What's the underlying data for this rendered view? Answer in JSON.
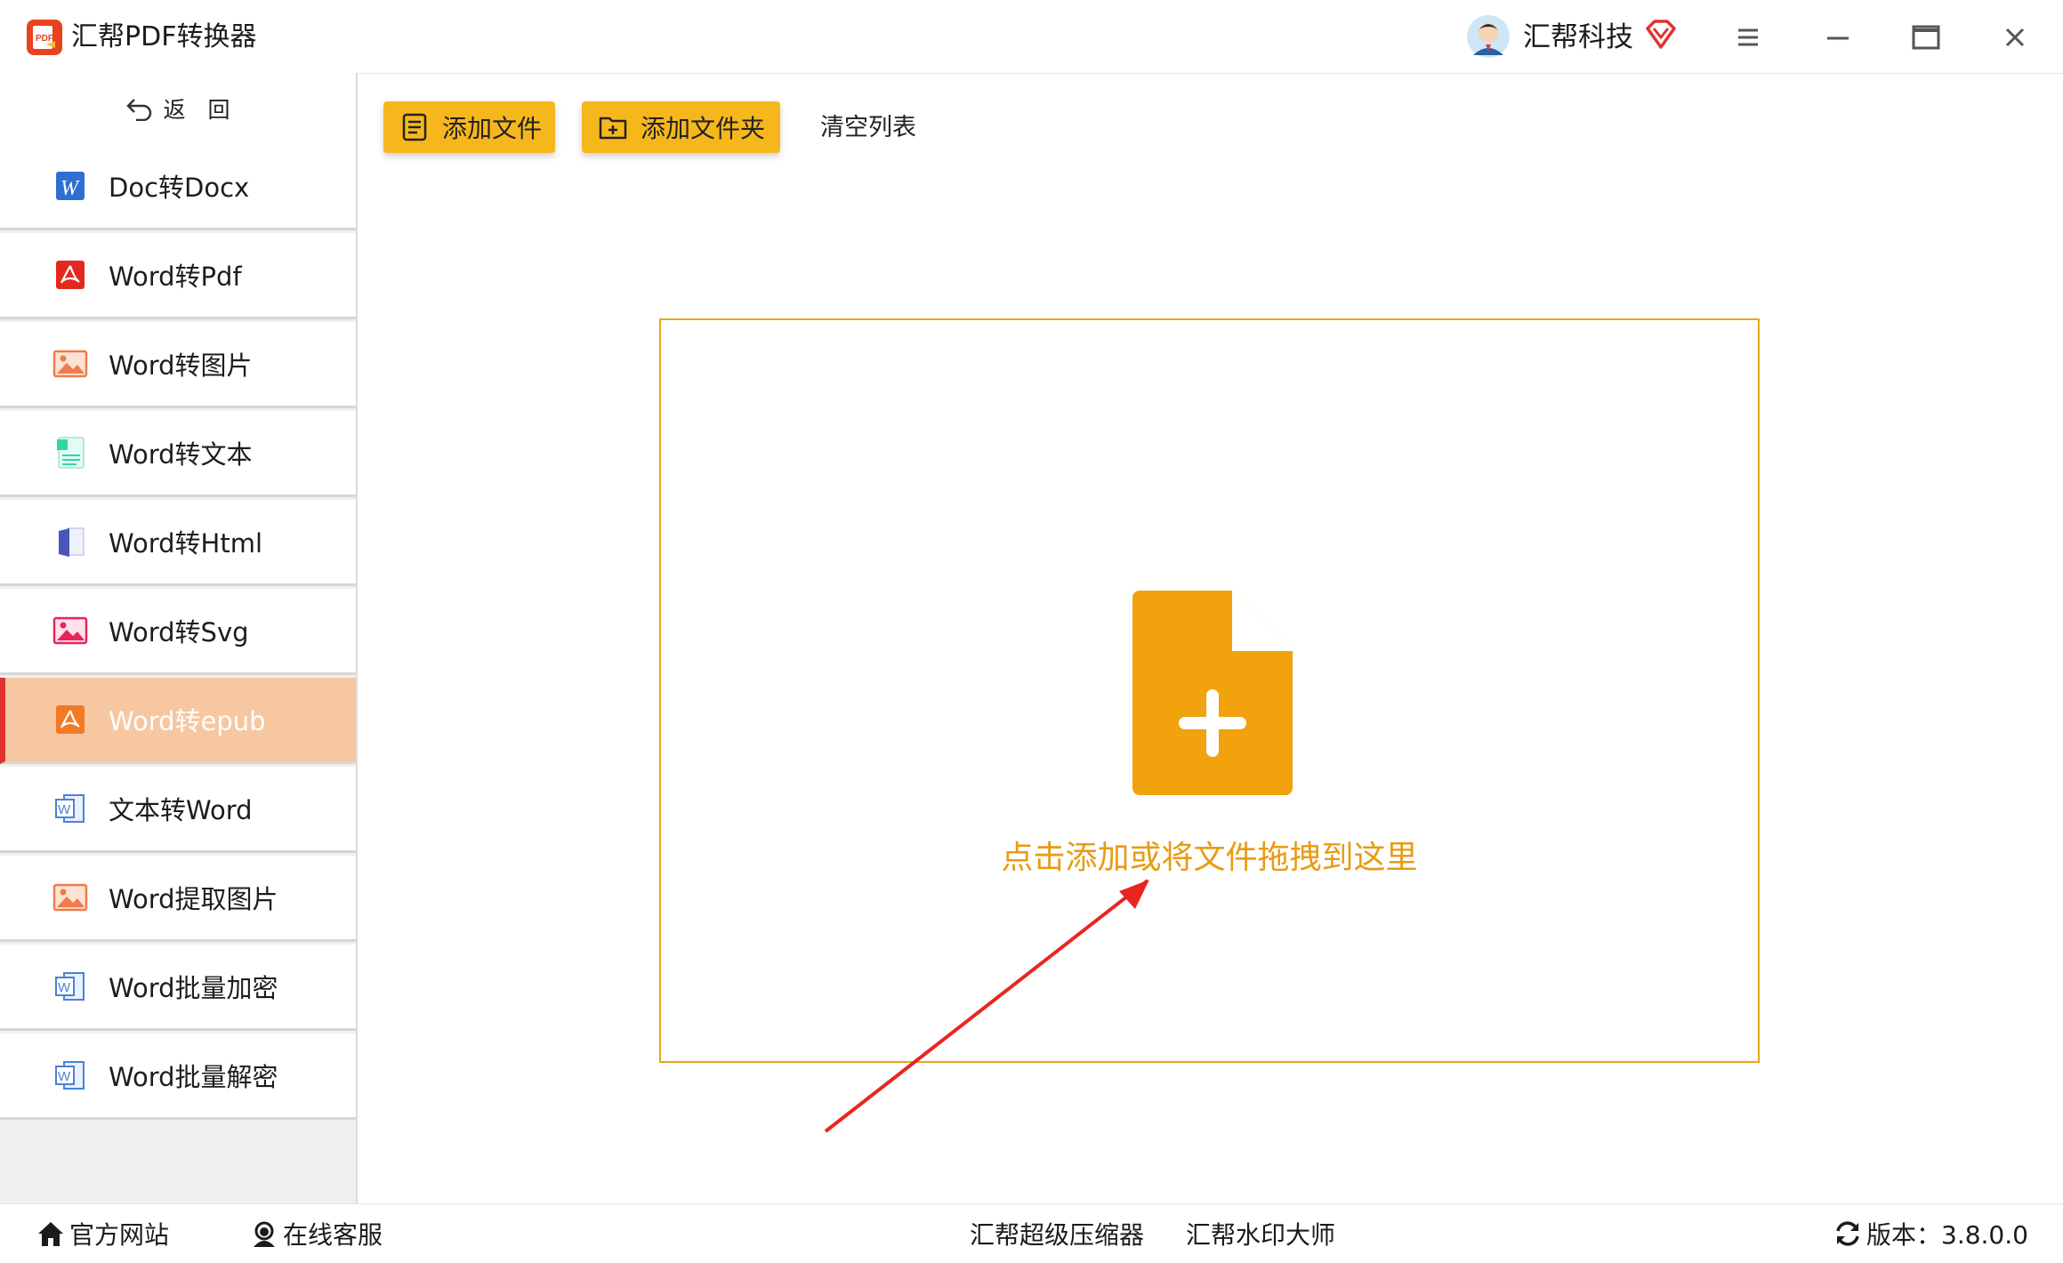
{
  "app": {
    "title": "汇帮PDF转换器"
  },
  "user": {
    "name": "汇帮科技"
  },
  "sidebar": {
    "back_label": "返　回",
    "items": [
      {
        "label": "Doc转Docx",
        "icon": "word-w-icon"
      },
      {
        "label": "Word转Pdf",
        "icon": "pdf-icon"
      },
      {
        "label": "Word转图片",
        "icon": "image-icon"
      },
      {
        "label": "Word转文本",
        "icon": "text-file-icon"
      },
      {
        "label": "Word转Html",
        "icon": "html-book-icon"
      },
      {
        "label": "Word转Svg",
        "icon": "image-icon"
      },
      {
        "label": "Word转epub",
        "icon": "pdf-icon",
        "active": true
      },
      {
        "label": "文本转Word",
        "icon": "word-doc-icon"
      },
      {
        "label": "Word提取图片",
        "icon": "image-icon"
      },
      {
        "label": "Word批量加密",
        "icon": "word-doc-icon"
      },
      {
        "label": "Word批量解密",
        "icon": "word-doc-icon"
      }
    ]
  },
  "toolbar": {
    "add_file": "添加文件",
    "add_folder": "添加文件夹",
    "clear_list": "清空列表"
  },
  "dropzone": {
    "text": "点击添加或将文件拖拽到这里"
  },
  "statusbar": {
    "website": "官方网站",
    "support": "在线客服",
    "compressor": "汇帮超级压缩器",
    "watermark": "汇帮水印大师",
    "version": "版本：3.8.0.0"
  },
  "colors": {
    "accent": "#f6b71d",
    "drop_border": "#e9a61c",
    "drop_text": "#e89b12",
    "active_item": "#f6c7a0",
    "active_marker": "#e0322e"
  }
}
